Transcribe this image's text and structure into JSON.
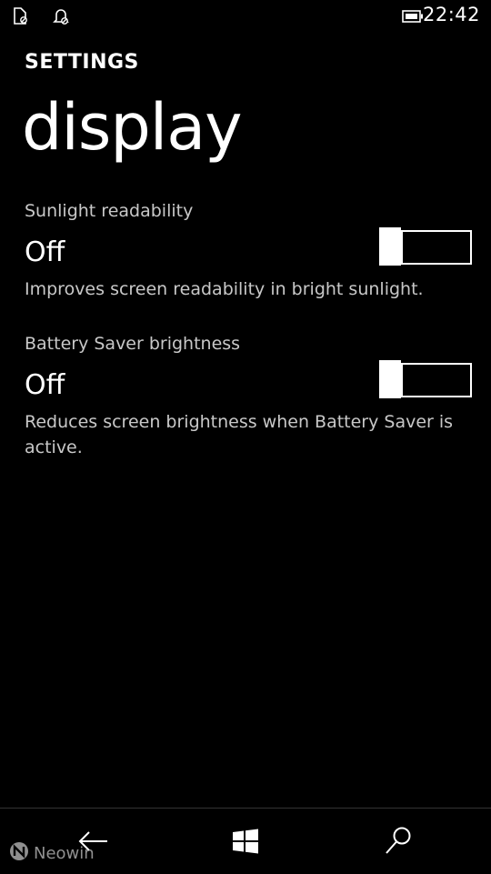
{
  "status_bar": {
    "time": "22:42",
    "icons": [
      "document-status-icon",
      "notification-status-icon",
      "battery-icon"
    ]
  },
  "header": {
    "app_name": "SETTINGS",
    "page_title": "display"
  },
  "settings": [
    {
      "label": "Sunlight readability",
      "value": "Off",
      "description": "Improves screen readability in bright sunlight.",
      "enabled": false
    },
    {
      "label": "Battery Saver brightness",
      "value": "Off",
      "description": "Reduces screen brightness when Battery Saver is active.",
      "enabled": false
    }
  ],
  "nav_bar": {
    "buttons": [
      "back-icon",
      "windows-icon",
      "search-icon"
    ]
  },
  "watermark": {
    "text": "Neowin"
  },
  "colors": {
    "background": "#000000",
    "foreground": "#ffffff",
    "secondary_text": "#c8c8c8"
  }
}
